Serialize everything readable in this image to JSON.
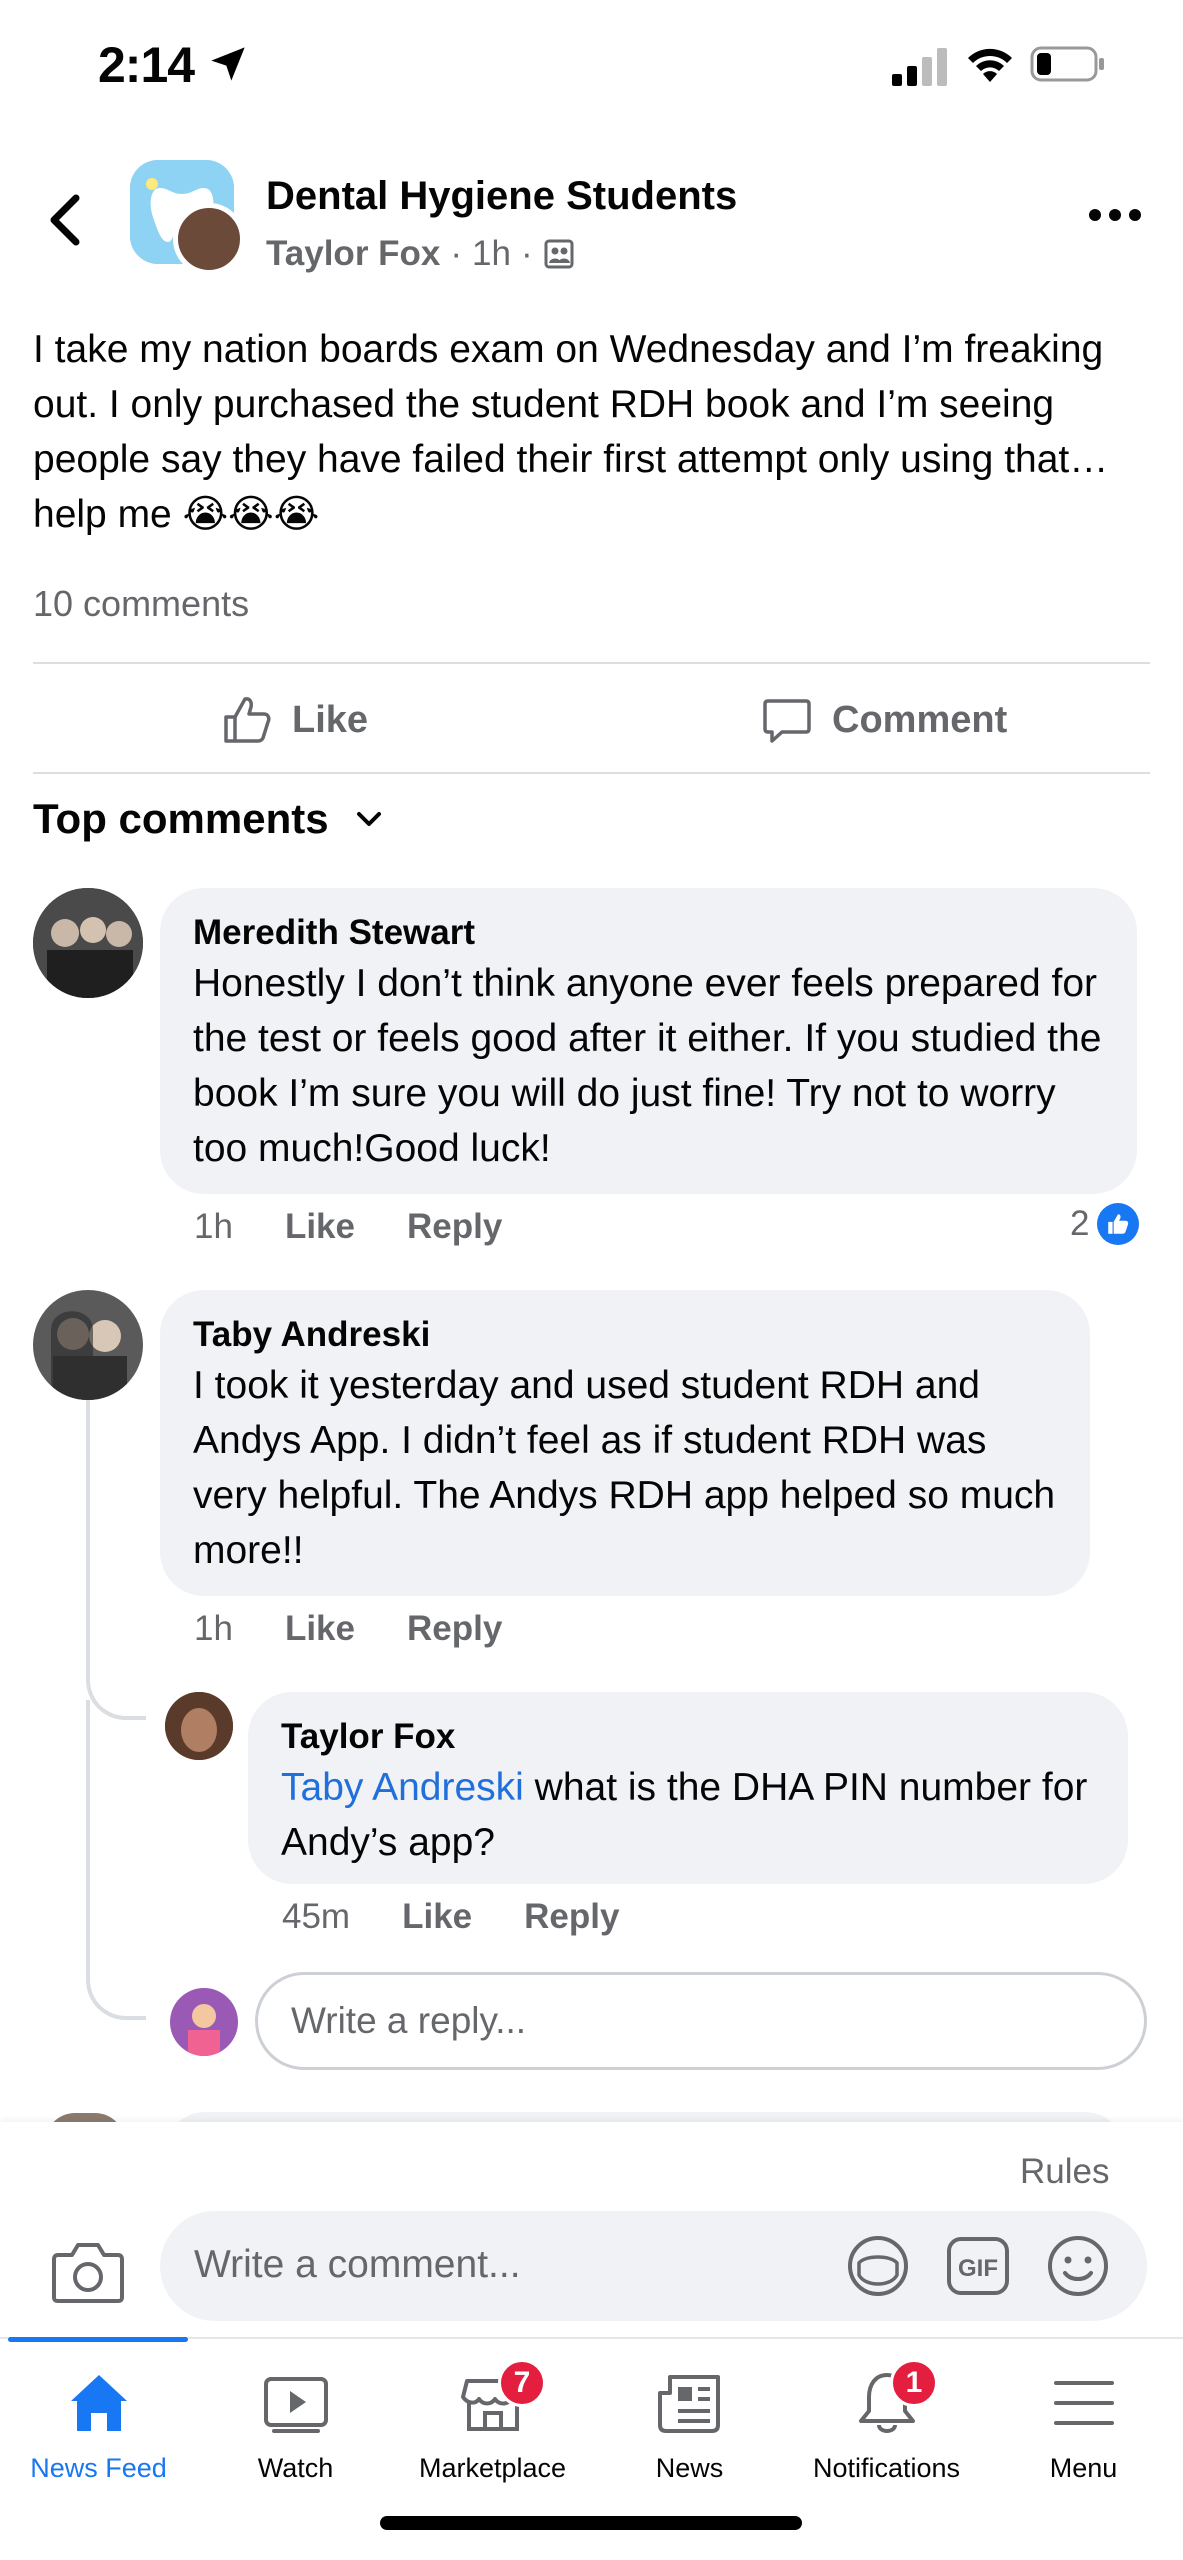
{
  "status_bar": {
    "time": "2:14"
  },
  "post": {
    "group_name": "Dental Hygiene Students",
    "author": "Taylor Fox",
    "time": "1h",
    "text": "I take my nation boards exam on Wednesday and I’m freaking out. I only purchased the student RDH book and I’m seeing people say they have failed their first attempt only using that… help me 😭😭😭",
    "comment_count": "10 comments"
  },
  "actions": {
    "like_label": "Like",
    "comment_label": "Comment"
  },
  "top_comments_label": "Top comments",
  "comments": [
    {
      "name": "Meredith Stewart",
      "text": "Honestly I don’t think anyone ever feels prepared for the test or feels good after it either. If you studied the book I’m sure you will do just fine! Try not to worry too much!Good luck!",
      "time": "1h",
      "like_label": "Like",
      "reply_label": "Reply",
      "reaction_count": "2"
    },
    {
      "name": "Taby Andreski",
      "text": "I took it yesterday and used student RDH and Andys App. I didn’t feel as if student RDH was very helpful. The Andys RDH app helped so much more!!",
      "time": "1h",
      "like_label": "Like",
      "reply_label": "Reply",
      "replies": [
        {
          "name": "Taylor Fox",
          "mention": "Taby Andreski",
          "text": " what is the DHA PIN number for Andy’s app?",
          "time": "45m",
          "like_label": "Like",
          "reply_label": "Reply"
        }
      ]
    }
  ],
  "reply_placeholder": "Write a reply...",
  "rules_label": "Rules",
  "comment_placeholder": "Write a comment...",
  "gif_label": "GIF",
  "tabs": [
    {
      "label": "News Feed",
      "active": true
    },
    {
      "label": "Watch"
    },
    {
      "label": "Marketplace",
      "badge": "7"
    },
    {
      "label": "News"
    },
    {
      "label": "Notifications",
      "badge": "1"
    },
    {
      "label": "Menu"
    }
  ],
  "colors": {
    "accent": "#1877f2",
    "badge": "#e41e3f",
    "secondary_text": "#65676b",
    "bubble_bg": "#f0f2f5",
    "mention": "#216fdb"
  }
}
